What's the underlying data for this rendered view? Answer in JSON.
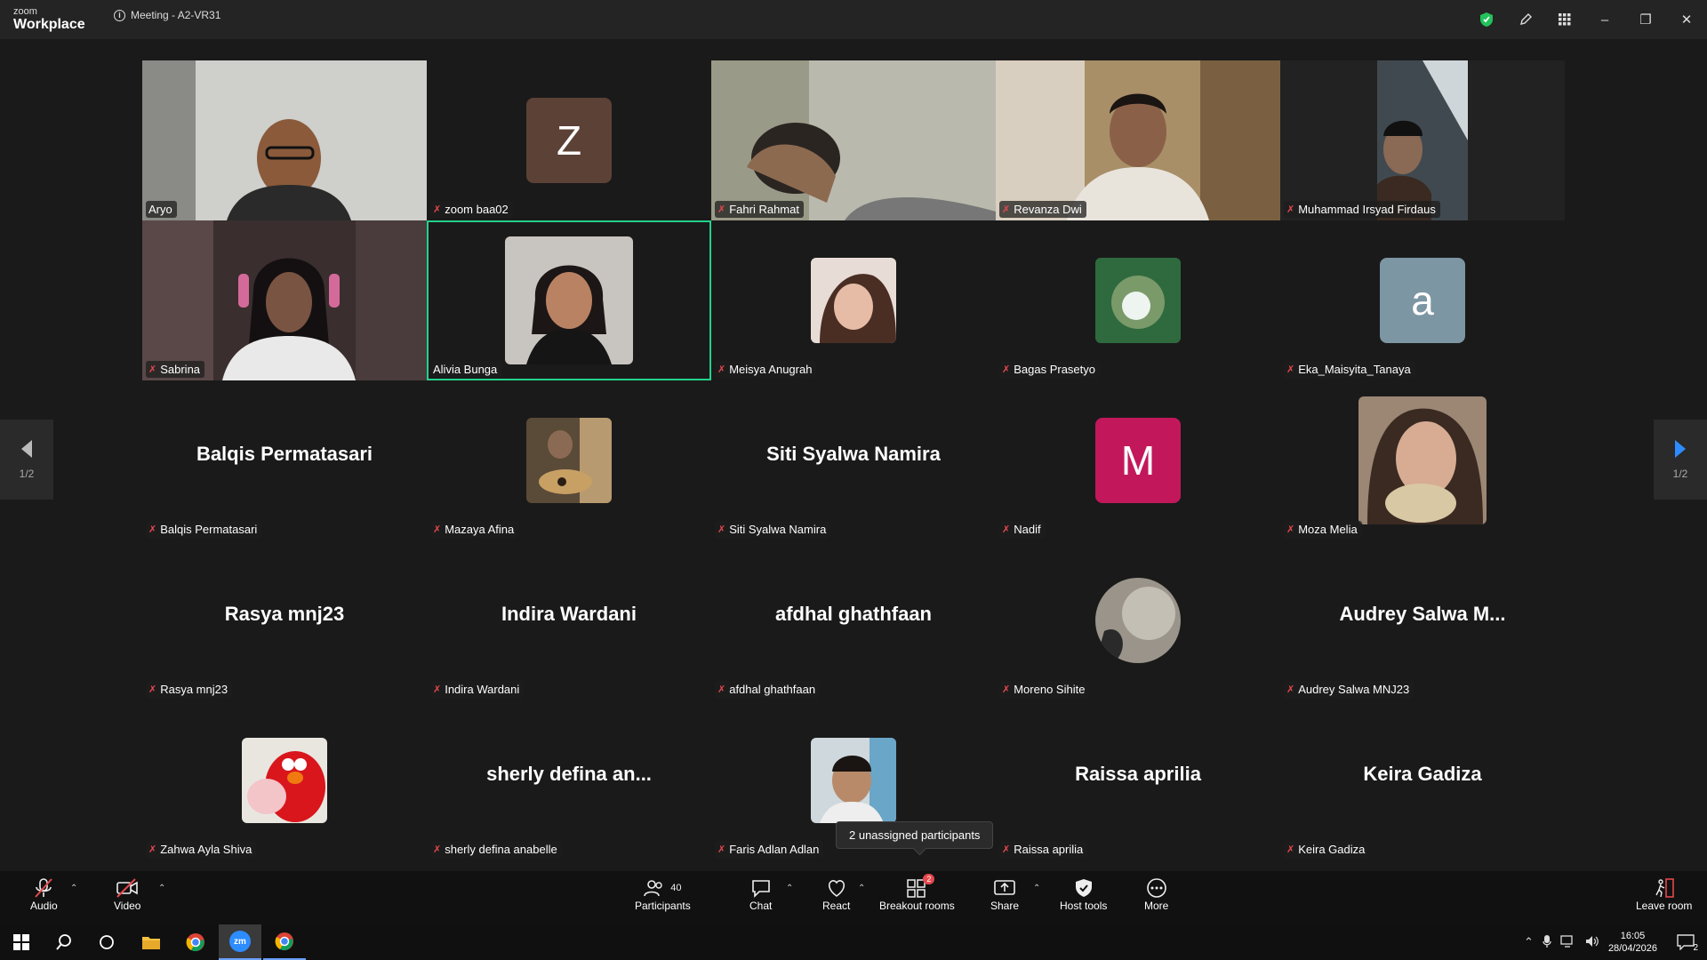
{
  "titlebar": {
    "brand_small": "zoom",
    "brand_big": "Workplace",
    "meeting_title": "Meeting - A2-VR31"
  },
  "participants": [
    {
      "name": "Aryo",
      "display": "video",
      "muted": false
    },
    {
      "name": "zoom baa02",
      "display": "avatar",
      "letter": "Z",
      "color": "#5c4136",
      "muted": true
    },
    {
      "name": "Fahri Rahmat",
      "display": "video",
      "muted": true
    },
    {
      "name": "Revanza Dwi",
      "display": "video",
      "muted": true
    },
    {
      "name": "Muhammad Irsyad Firdaus",
      "display": "video",
      "muted": true
    },
    {
      "name": "Sabrina",
      "display": "video",
      "muted": true
    },
    {
      "name": "Alivia Bunga",
      "display": "photo",
      "muted": false,
      "active": true
    },
    {
      "name": "Meisya Anugrah",
      "display": "photo",
      "muted": true
    },
    {
      "name": "Bagas Prasetyo",
      "display": "photo",
      "muted": true
    },
    {
      "name": "Eka_Maisyita_Tanaya",
      "display": "avatar",
      "letter": "a",
      "color": "#7d96a3",
      "muted": true
    },
    {
      "name": "Balqis Permatasari",
      "display": "text",
      "big": "Balqis Permatasari",
      "muted": true
    },
    {
      "name": "Mazaya Afina",
      "display": "photo",
      "muted": true
    },
    {
      "name": "Siti Syalwa Namira",
      "display": "text",
      "big": "Siti Syalwa Namira",
      "muted": true
    },
    {
      "name": "Nadif",
      "display": "avatar",
      "letter": "M",
      "color": "#c2185b",
      "muted": true
    },
    {
      "name": "Moza Melia",
      "display": "photo",
      "muted": true
    },
    {
      "name": "Rasya mnj23",
      "display": "text",
      "big": "Rasya mnj23",
      "muted": true
    },
    {
      "name": "Indira Wardani",
      "display": "text",
      "big": "Indira Wardani",
      "muted": true
    },
    {
      "name": "afdhal ghathfaan",
      "display": "text",
      "big": "afdhal ghathfaan",
      "muted": true
    },
    {
      "name": "Moreno Sihite",
      "display": "photo",
      "muted": true
    },
    {
      "name": "Audrey Salwa MNJ23",
      "display": "text",
      "big": "Audrey Salwa M...",
      "muted": true
    },
    {
      "name": "Zahwa Ayla Shiva",
      "display": "photo",
      "muted": true
    },
    {
      "name": "sherly defina anabelle",
      "display": "text",
      "big": "sherly defina an...",
      "muted": true
    },
    {
      "name": "Faris Adlan Adlan",
      "display": "photo",
      "muted": true
    },
    {
      "name": "Raissa aprilia",
      "display": "text",
      "big": "Raissa aprilia",
      "muted": true
    },
    {
      "name": "Keira Gadiza",
      "display": "text",
      "big": "Keira Gadiza",
      "muted": true
    }
  ],
  "pagination": {
    "left": "1/2",
    "right": "1/2"
  },
  "tooltip": "2 unassigned participants",
  "toolbar": {
    "audio": "Audio",
    "video": "Video",
    "participants": "Participants",
    "participants_count": "40",
    "chat": "Chat",
    "react": "React",
    "breakout": "Breakout rooms",
    "breakout_badge": "2",
    "share": "Share",
    "host_tools": "Host tools",
    "more": "More",
    "leave": "Leave room"
  },
  "taskbar": {
    "time": "16:05",
    "date": "28/04/2026",
    "notifications": "2",
    "zoom_label": "zm"
  },
  "colors": {
    "active_border": "#23d18b",
    "mute": "#e5484d",
    "accent": "#2d8cff"
  }
}
